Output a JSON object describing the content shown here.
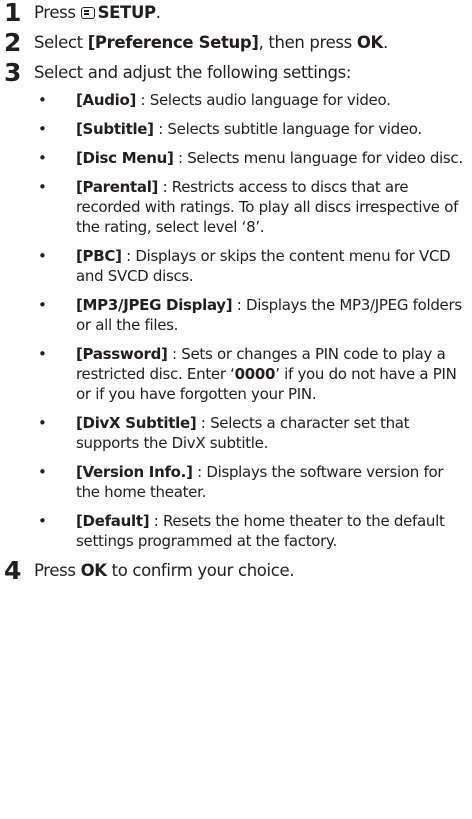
{
  "steps": [
    {
      "num": "1",
      "pre": "Press ",
      "icon": "setup-menu-icon",
      "bold": "SETUP",
      "post": "."
    },
    {
      "num": "2",
      "pre": "Select ",
      "bold1": "[Preference Setup]",
      "mid": ", then press ",
      "bold2": "OK",
      "post": "."
    },
    {
      "num": "3",
      "text": "Select and adjust the following settings:"
    },
    {
      "num": "4",
      "pre": "Press ",
      "bold": "OK",
      "post": " to confirm your choice."
    }
  ],
  "settings": [
    {
      "key": "[Audio]",
      "desc": " : Selects audio language for video."
    },
    {
      "key": "[Subtitle]",
      "desc": " : Selects subtitle language for video."
    },
    {
      "key": "[Disc Menu]",
      "desc": " : Selects menu language for video disc."
    },
    {
      "key": "[Parental]",
      "desc": " : Restricts access to discs that are recorded with ratings. To play all discs irrespective of the rating, select level ‘8’."
    },
    {
      "key": "[PBC]",
      "desc": " : Displays or skips the content menu for VCD and SVCD discs."
    },
    {
      "key": "[MP3/JPEG Display]",
      "desc": " : Displays the MP3/JPEG folders or all the files."
    },
    {
      "key": "[Password]",
      "desc": " : Sets or changes a PIN code to play a restricted disc. Enter ‘",
      "code": "0000",
      "desc2": "’ if you do not have a PIN or if you have forgotten your PIN."
    },
    {
      "key": "[DivX Subtitle]",
      "desc": " : Selects a character set that supports the DivX subtitle."
    },
    {
      "key": "[Version Info.]",
      "desc": " : Displays the software version for the home theater."
    },
    {
      "key": "[Default]",
      "desc": " : Resets the home theater to the default settings programmed at the factory."
    }
  ],
  "bullet_char": "•"
}
